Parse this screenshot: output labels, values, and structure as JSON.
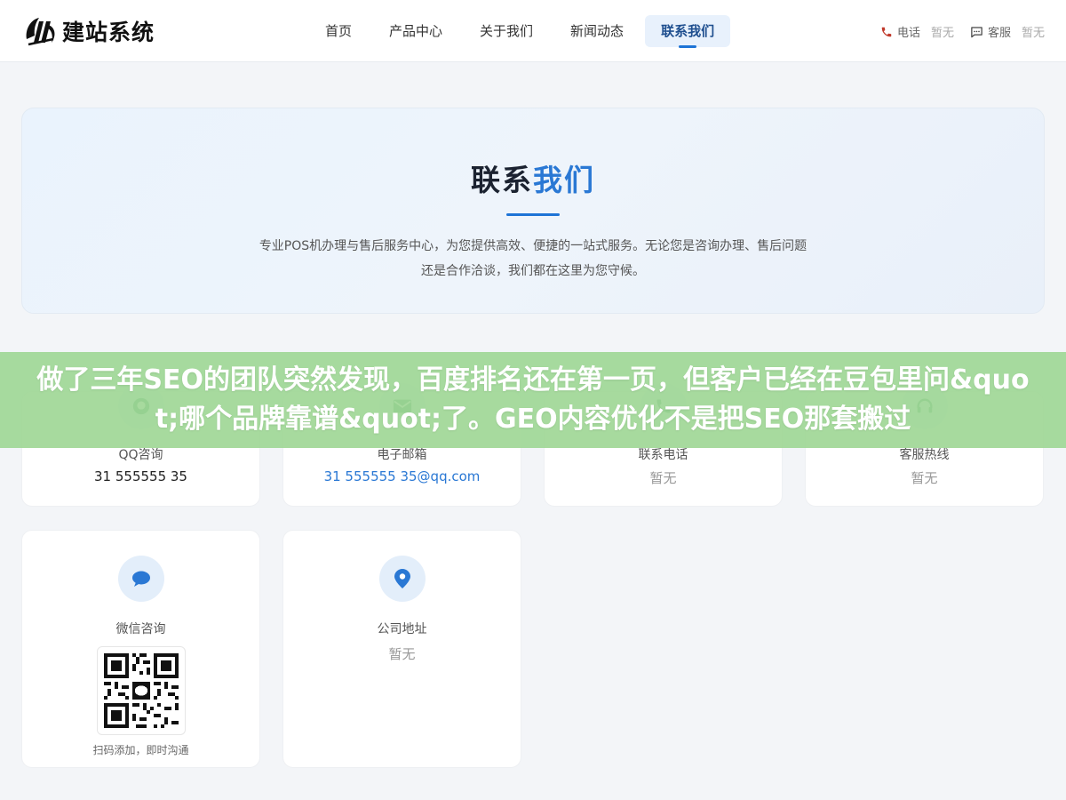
{
  "brand": {
    "logo_text": "建站系统"
  },
  "nav": {
    "items": [
      {
        "label": "首页"
      },
      {
        "label": "产品中心"
      },
      {
        "label": "关于我们"
      },
      {
        "label": "新闻动态"
      },
      {
        "label": "联系我们"
      }
    ],
    "active_index": 4
  },
  "header_contact": {
    "phone_label": "电话",
    "phone_value": "暂无",
    "service_label": "客服",
    "service_value": "暂无"
  },
  "hero": {
    "title_prefix": "联系",
    "title_accent": "我们",
    "description": "专业POS机办理与售后服务中心，为您提供高效、便捷的一站式服务。无论您是咨询办理、售后问题还是合作洽谈，我们都在这里为您守候。"
  },
  "cards": {
    "qq": {
      "label": "QQ咨询",
      "value": "31 555555 35",
      "icon": "qq-icon"
    },
    "email": {
      "label": "电子邮箱",
      "value": "31 555555 35@qq.com",
      "icon": "mail-icon"
    },
    "phone": {
      "label": "联系电话",
      "value": "暂无",
      "icon": "phone-icon"
    },
    "hotline": {
      "label": "客服热线",
      "value": "暂无",
      "icon": "headset-icon"
    },
    "wechat": {
      "label": "微信咨询",
      "caption": "扫码添加，即时沟通",
      "icon": "chat-bubble-icon"
    },
    "address": {
      "label": "公司地址",
      "value": "暂无",
      "icon": "location-pin-icon"
    }
  },
  "overlay": {
    "text": "做了三年SEO的团队突然发现，百度排名还在第一页，但客户已经在豆包里问&quot;哪个品牌靠谱&quot;了。GEO内容优化不是把SEO那套搬过"
  },
  "colors": {
    "accent": "#1e74d6",
    "link": "#2a78d4",
    "overlay": "#a0d796"
  }
}
